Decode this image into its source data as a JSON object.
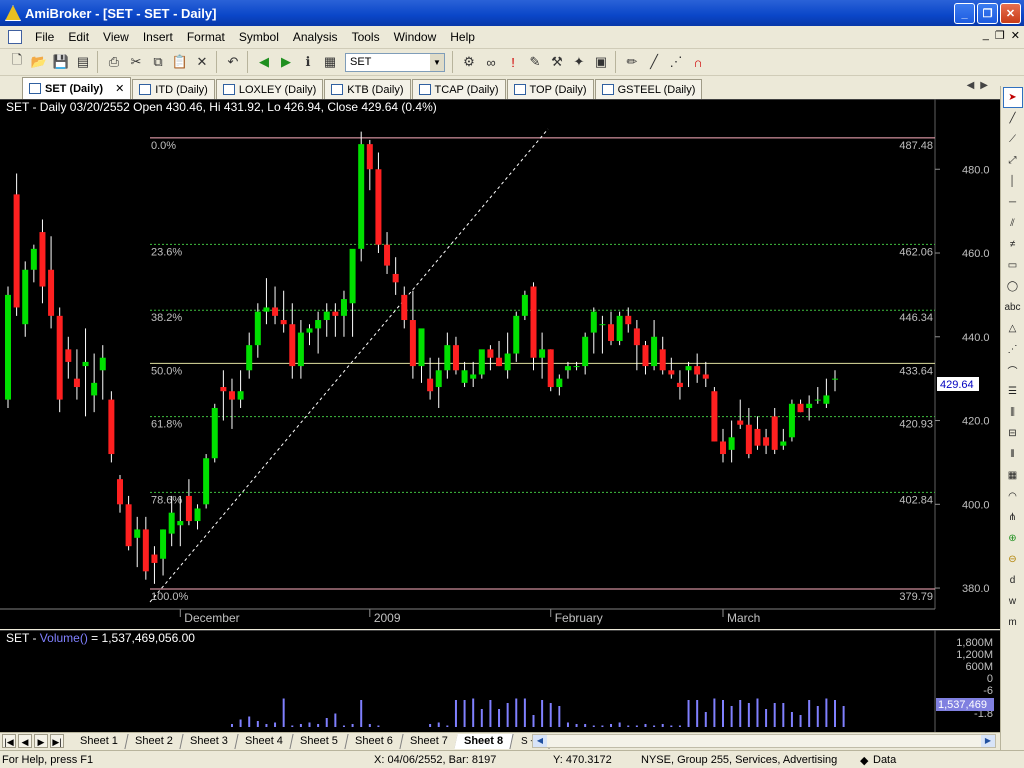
{
  "window": {
    "title": "AmiBroker - [SET - SET - Daily]"
  },
  "menu": [
    "File",
    "Edit",
    "View",
    "Insert",
    "Format",
    "Symbol",
    "Analysis",
    "Tools",
    "Window",
    "Help"
  ],
  "toolbar": {
    "symbol": "SET"
  },
  "tabs": [
    {
      "label": "SET (Daily)",
      "active": true
    },
    {
      "label": "ITD (Daily)"
    },
    {
      "label": "LOXLEY (Daily)"
    },
    {
      "label": "KTB (Daily)"
    },
    {
      "label": "TCAP (Daily)"
    },
    {
      "label": "TOP (Daily)"
    },
    {
      "label": "GSTEEL (Daily)"
    }
  ],
  "price_pane": {
    "header": "SET - Daily 03/20/2552 Open 430.46, Hi 431.92, Lo 426.94, Close 429.64 (0.4%)",
    "current_price": "429.64",
    "colors": {
      "up": "#00e000",
      "down": "#ff2020",
      "fib": "#40c040"
    }
  },
  "chart_data": {
    "type": "candlestick",
    "ylim": [
      375,
      492
    ],
    "y_ticks": [
      "480.0",
      "460.0",
      "440.0",
      "420.0",
      "400.0",
      "380.0"
    ],
    "x_labels": [
      "December",
      "2009",
      "February",
      "March"
    ],
    "fib_levels": [
      {
        "label": "0.0%",
        "value": "487.48"
      },
      {
        "label": "23.6%",
        "value": "462.06"
      },
      {
        "label": "38.2%",
        "value": "446.34"
      },
      {
        "label": "50.0%",
        "value": "433.64"
      },
      {
        "label": "61.8%",
        "value": "420.93"
      },
      {
        "label": "78.6%",
        "value": "402.84"
      },
      {
        "label": "100.0%",
        "value": "379.79"
      }
    ],
    "candles": [
      [
        425,
        452,
        423,
        450
      ],
      [
        474,
        479,
        445,
        447
      ],
      [
        443,
        458,
        440,
        456
      ],
      [
        456,
        462,
        453,
        461
      ],
      [
        465,
        468,
        448,
        452
      ],
      [
        456,
        464,
        442,
        445
      ],
      [
        445,
        447,
        422,
        425
      ],
      [
        437,
        440,
        430,
        434
      ],
      [
        430,
        437,
        425,
        428
      ],
      [
        433,
        442,
        421,
        434
      ],
      [
        426,
        436,
        422,
        429
      ],
      [
        432,
        438,
        425,
        435
      ],
      [
        425,
        427,
        410,
        412
      ],
      [
        406,
        407,
        398,
        400
      ],
      [
        400,
        402,
        389,
        390
      ],
      [
        392,
        397,
        385,
        394
      ],
      [
        394,
        397,
        382,
        384
      ],
      [
        388,
        390,
        381,
        386
      ],
      [
        387,
        394,
        383,
        394
      ],
      [
        393,
        402,
        390,
        398
      ],
      [
        395,
        402,
        390,
        396
      ],
      [
        402,
        406,
        395,
        396
      ],
      [
        396,
        400,
        394,
        399
      ],
      [
        400,
        412,
        399,
        411
      ],
      [
        411,
        424,
        410,
        423
      ],
      [
        428,
        432,
        420,
        427
      ],
      [
        427,
        430,
        418,
        425
      ],
      [
        425,
        432,
        423,
        427
      ],
      [
        432,
        441,
        430,
        438
      ],
      [
        438,
        448,
        435,
        446
      ],
      [
        446,
        454,
        443,
        447
      ],
      [
        447,
        452,
        443,
        445
      ],
      [
        444,
        451,
        441,
        443
      ],
      [
        443,
        448,
        430,
        433
      ],
      [
        433,
        444,
        430,
        441
      ],
      [
        441,
        443,
        438,
        442
      ],
      [
        442,
        446,
        436,
        444
      ],
      [
        444,
        448,
        440,
        446
      ],
      [
        446,
        448,
        440,
        445
      ],
      [
        445,
        451,
        440,
        449
      ],
      [
        448,
        459,
        440,
        461
      ],
      [
        461,
        489,
        458,
        486
      ],
      [
        486,
        487,
        475,
        480
      ],
      [
        480,
        484,
        460,
        462
      ],
      [
        462,
        465,
        455,
        457
      ],
      [
        455,
        459,
        450,
        453
      ],
      [
        450,
        452,
        442,
        444
      ],
      [
        444,
        451,
        430,
        433
      ],
      [
        433,
        441,
        429,
        442
      ],
      [
        430,
        435,
        425,
        427
      ],
      [
        428,
        435,
        423,
        432
      ],
      [
        432,
        441,
        430,
        438
      ],
      [
        438,
        440,
        431,
        432
      ],
      [
        429,
        434,
        428,
        432
      ],
      [
        430,
        434,
        428,
        431
      ],
      [
        431,
        436,
        430,
        437
      ],
      [
        437,
        438,
        432,
        435
      ],
      [
        435,
        439,
        433,
        433
      ],
      [
        432,
        441,
        430,
        436
      ],
      [
        436,
        446,
        434,
        445
      ],
      [
        445,
        451,
        444,
        450
      ],
      [
        452,
        453,
        432,
        435
      ],
      [
        435,
        441,
        430,
        437
      ],
      [
        437,
        437,
        427,
        428
      ],
      [
        428,
        431,
        426,
        430
      ],
      [
        432,
        434,
        430,
        433
      ],
      [
        433,
        434,
        432,
        433
      ],
      [
        433,
        441,
        431,
        440
      ],
      [
        441,
        447,
        436,
        446
      ],
      [
        443,
        445,
        436,
        443
      ],
      [
        443,
        446,
        438,
        439
      ],
      [
        439,
        446,
        438,
        445
      ],
      [
        445,
        447,
        441,
        443
      ],
      [
        442,
        444,
        432,
        438
      ],
      [
        438,
        439,
        431,
        433
      ],
      [
        433,
        444,
        432,
        440
      ],
      [
        437,
        440,
        431,
        432
      ],
      [
        432,
        435,
        430,
        431
      ],
      [
        429,
        432,
        425,
        428
      ],
      [
        432,
        434,
        428,
        433
      ],
      [
        433,
        436,
        429,
        431
      ],
      [
        431,
        434,
        428,
        430
      ],
      [
        427,
        428,
        415,
        415
      ],
      [
        415,
        418,
        410,
        412
      ],
      [
        413,
        420,
        410,
        416
      ],
      [
        420,
        425,
        418,
        419
      ],
      [
        419,
        423,
        411,
        412
      ],
      [
        418,
        421,
        413,
        414
      ],
      [
        416,
        418,
        412,
        414
      ],
      [
        421,
        423,
        412,
        413
      ],
      [
        414,
        418,
        413,
        415
      ],
      [
        416,
        425,
        415,
        424
      ],
      [
        424,
        425,
        422,
        422
      ],
      [
        423,
        426,
        420,
        424
      ],
      [
        425,
        428,
        424,
        425
      ],
      [
        424,
        430,
        423,
        426
      ],
      [
        430,
        432,
        427,
        430
      ]
    ],
    "volume": {
      "label": "Volume()",
      "value": "1,537,469,056.00",
      "y_ticks": [
        "1,800M",
        "1,200M",
        "600M",
        "0",
        "-6",
        "-1.8"
      ],
      "current": "1,537,469",
      "bars": [
        0,
        0,
        0,
        0,
        0,
        0,
        0,
        0,
        0,
        0,
        0,
        0,
        0,
        0,
        0,
        0,
        0,
        0,
        0,
        0,
        0,
        0,
        0,
        0,
        0,
        0,
        0.1,
        0.25,
        0.35,
        0.2,
        0.1,
        0.15,
        0.95,
        0.05,
        0.1,
        0.15,
        0.1,
        0.3,
        0.45,
        0.05,
        0.1,
        0.9,
        0.1,
        0.05,
        0,
        0,
        0,
        0,
        0,
        0.1,
        0.15,
        0.05,
        0.9,
        0.9,
        0.95,
        0.6,
        0.9,
        0.6,
        0.8,
        0.95,
        0.95,
        0.4,
        0.9,
        0.8,
        0.7,
        0.15,
        0.1,
        0.1,
        0.05,
        0.05,
        0.1,
        0.15,
        0.05,
        0.05,
        0.1,
        0.05,
        0.1,
        0.05,
        0.05,
        0.9,
        0.9,
        0.5,
        0.95,
        0.9,
        0.7,
        0.9,
        0.8,
        0.95,
        0.6,
        0.8,
        0.8,
        0.5,
        0.4,
        0.9,
        0.7,
        0.95,
        0.9,
        0.7
      ]
    }
  },
  "sheets": [
    "Sheet 1",
    "Sheet 2",
    "Sheet 3",
    "Sheet 4",
    "Sheet 5",
    "Sheet 6",
    "Sheet 7",
    "Sheet 8"
  ],
  "sheet_extra": "S ÷ I",
  "status": {
    "help": "For Help, press F1",
    "x": "X: 04/06/2552, Bar: 8197",
    "y": "Y: 470.3172",
    "info": "NYSE, Group 255, Services, Advertising",
    "data": "Data"
  }
}
